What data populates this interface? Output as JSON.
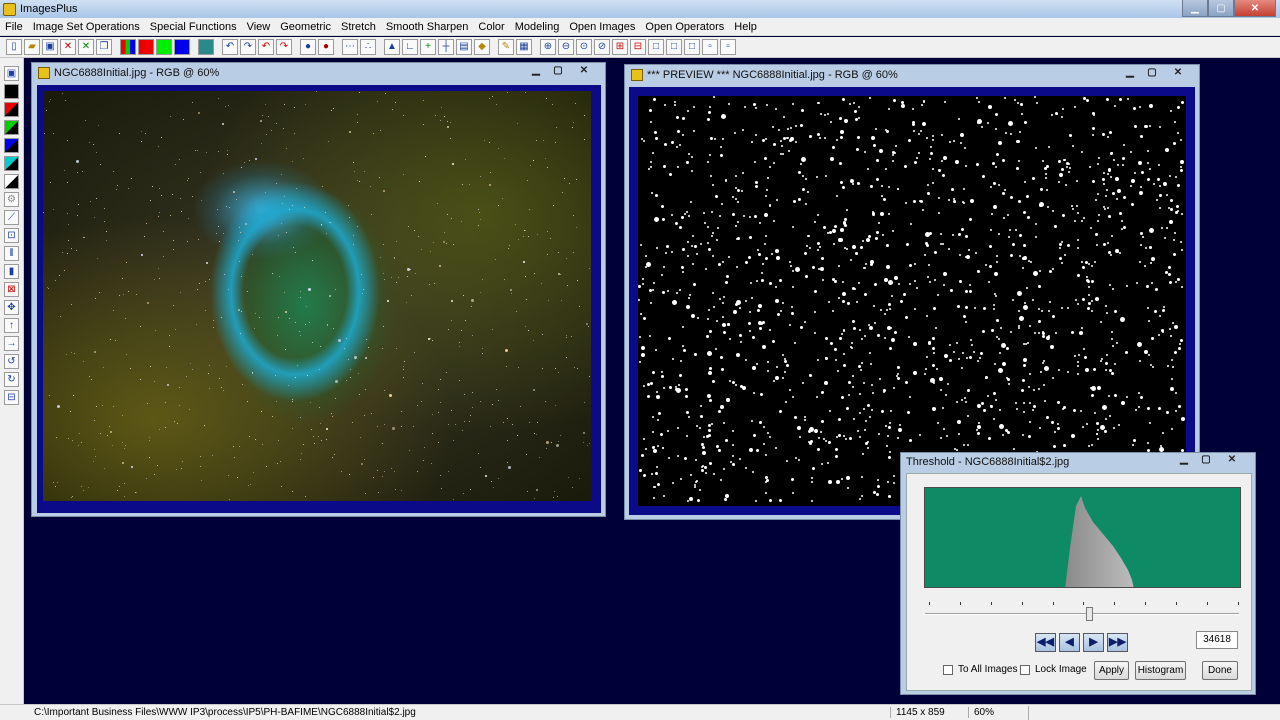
{
  "app": {
    "title": "ImagesPlus"
  },
  "menu": [
    "File",
    "Image Set Operations",
    "Special Functions",
    "View",
    "Geometric",
    "Stretch",
    "Smooth Sharpen",
    "Color",
    "Modeling",
    "Open Images",
    "Open Operators",
    "Help"
  ],
  "windows": {
    "original": {
      "title": "NGC6888Initial.jpg - RGB @ 60%"
    },
    "preview": {
      "title": "*** PREVIEW *** NGC6888Initial.jpg - RGB @ 60%"
    }
  },
  "threshold_dialog": {
    "title": "Threshold - NGC6888Initial$2.jpg",
    "value": "34618",
    "slider_position_fraction": 0.53,
    "to_all_images_label": "To All Images",
    "lock_image_label": "Lock Image",
    "apply_label": "Apply",
    "histogram_label": "Histogram",
    "done_label": "Done",
    "colors": {
      "histogram_bg": "#0e8a64",
      "histogram_fill": "#a8a8a8"
    }
  },
  "status": {
    "path": "C:\\Important Business Files\\WWW IP3\\process\\IP5\\PH-BAFIME\\NGC6888Initial$2.jpg",
    "dimensions": "1145 x 859",
    "zoom": "60%"
  },
  "icons": {
    "toolbar": [
      "new-file-icon",
      "open-folder-icon",
      "save-icon",
      "close-red-icon",
      "close-green-icon",
      "copy-icon",
      "rgb-channels-icon",
      "red-channel-icon",
      "green-channel-icon",
      "blue-channel-icon",
      "grid-icon",
      "undo-icon",
      "redo-icon",
      "undo-red-icon",
      "redo-red-icon",
      "circle-mask-icon",
      "circle-red-icon",
      "dots-icon",
      "scatter-icon",
      "histogram-icon",
      "crop-icon",
      "add-green-icon",
      "crosshair-icon",
      "levels-icon",
      "brush-icon",
      "pencil-icon",
      "table-icon",
      "zoom-in-icon",
      "zoom-out-icon",
      "zoom-fit-icon",
      "zoom-reset-icon",
      "add-red-icon",
      "remove-red-icon",
      "frame-1-icon",
      "frame-2-icon",
      "frame-3-icon",
      "frame-4-icon",
      "frame-5-icon"
    ],
    "lefttools": [
      "save-icon",
      "black-square-icon",
      "red-black-icon",
      "green-black-icon",
      "blue-black-icon",
      "cyan-black-icon",
      "black-white-icon",
      "gear-icon",
      "diagonal-icon",
      "target-icon",
      "bars-icon",
      "black-bar-icon",
      "magnify-icon",
      "move-icon",
      "arrow-up-icon",
      "arrow-right-icon",
      "rotate-left-icon",
      "rotate-right-icon",
      "fit-icon"
    ]
  }
}
